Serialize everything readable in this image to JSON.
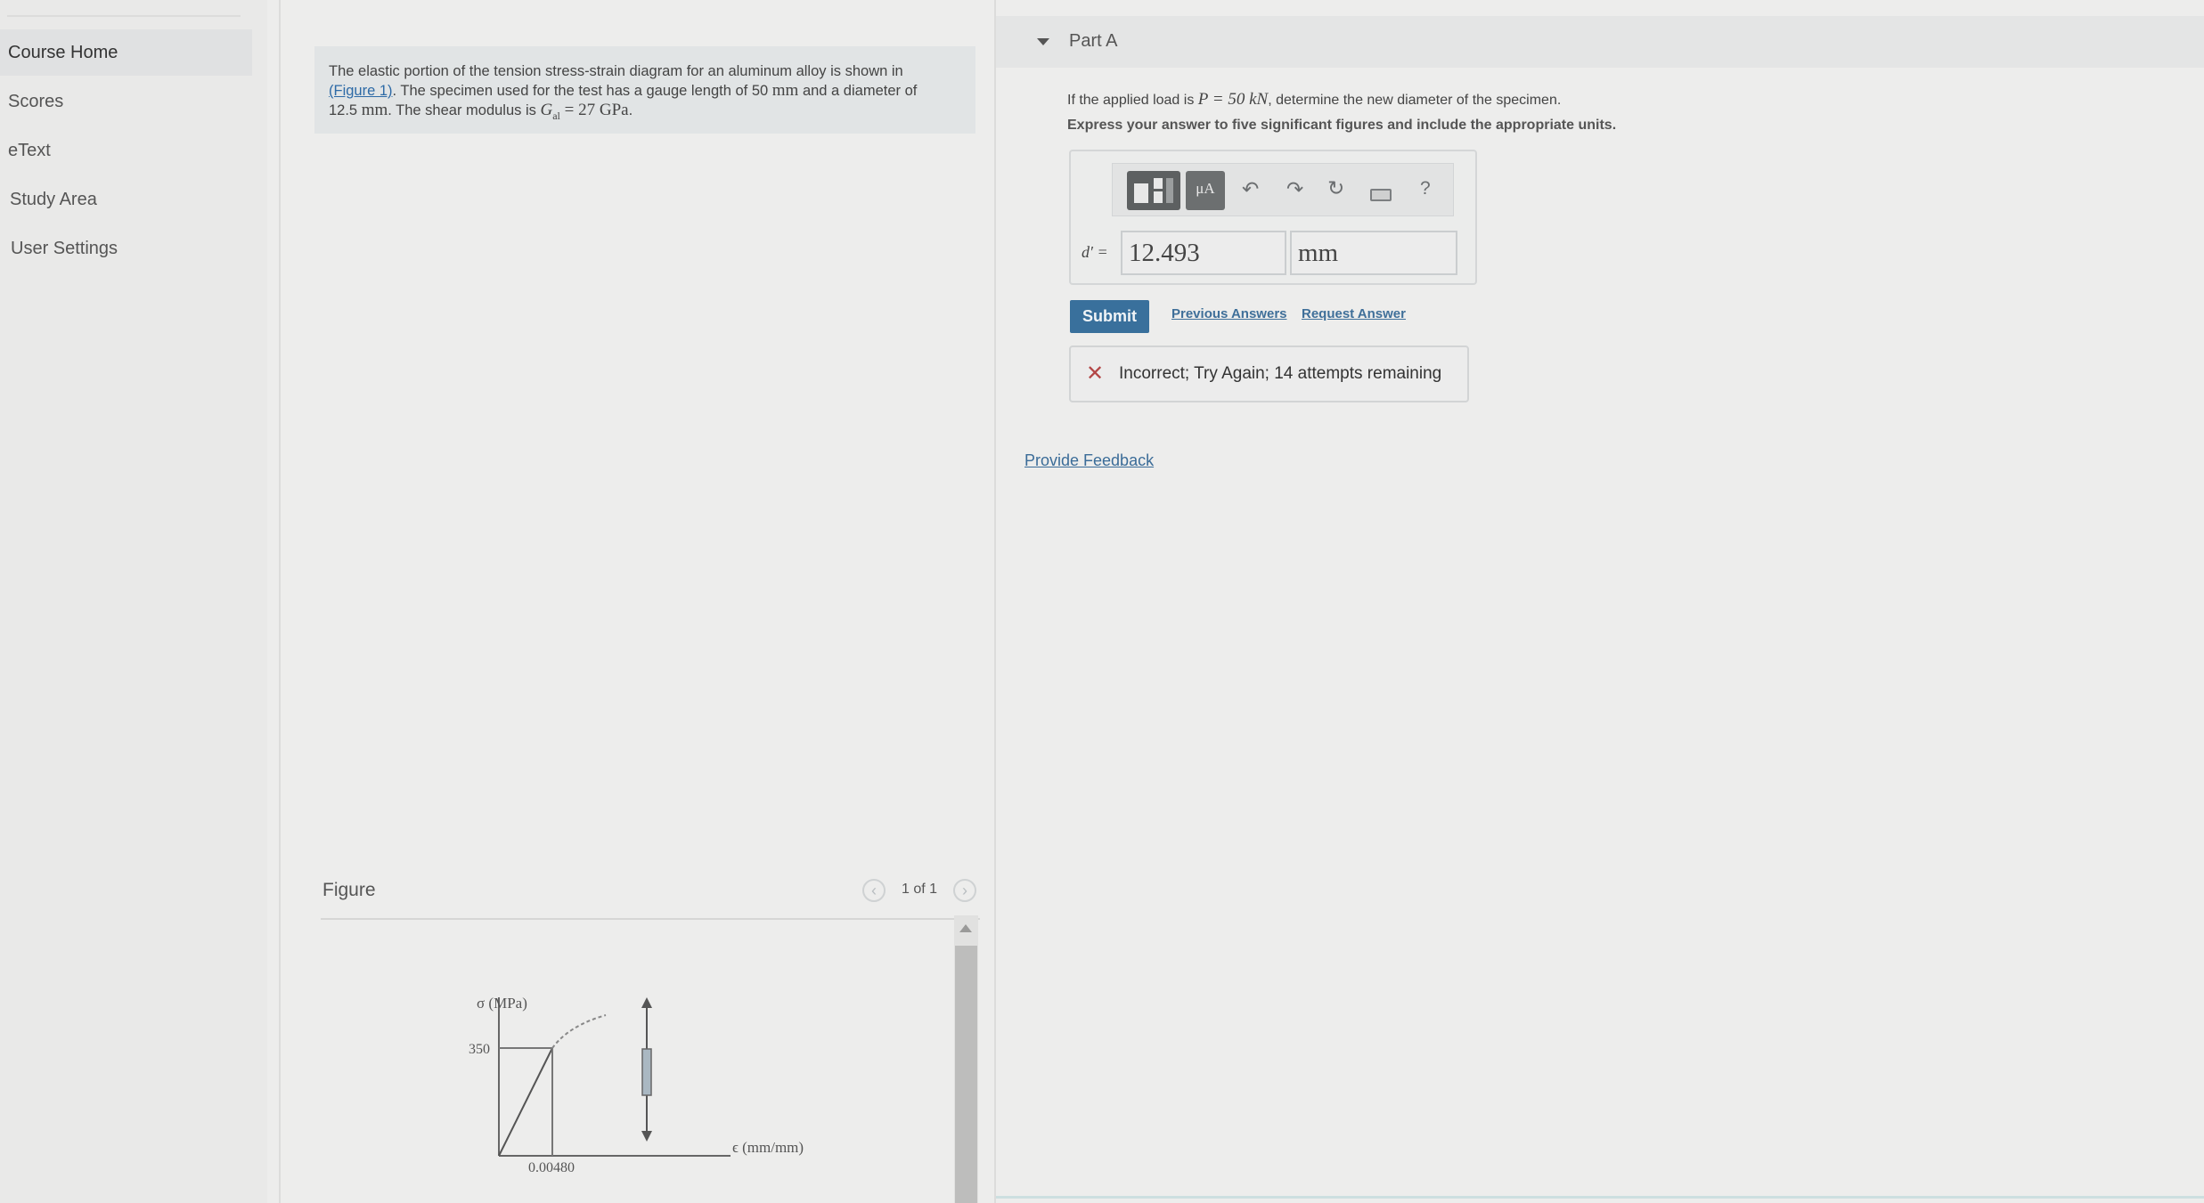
{
  "sidebar": {
    "items": [
      {
        "label": "Course Home",
        "active": true
      },
      {
        "label": "Scores"
      },
      {
        "label": "eText"
      },
      {
        "label": "Study Area"
      },
      {
        "label": "User Settings"
      }
    ]
  },
  "problem": {
    "text_1": "The elastic portion of the tension stress-strain diagram for an aluminum alloy is shown in",
    "figure_link": "(Figure 1)",
    "text_2": ". The specimen used for the test has a gauge length of 50",
    "unit_mm": "mm",
    "text_3": "and a diameter of",
    "diameter": "12.5",
    "text_4": ". The shear modulus is",
    "g_symbol": "G",
    "g_sub": "al",
    "g_value": "= 27 GPa",
    "end": "."
  },
  "figure": {
    "title": "Figure",
    "pager": "1 of 1",
    "prev_icon": "chevron-left-icon",
    "next_icon": "chevron-right-icon",
    "stress_axis_label": "σ (MPa)",
    "stress_tick": "350",
    "strain_tick": "0.00480",
    "strain_axis_label": "ϵ (mm/mm)",
    "yield_stress": 350,
    "yield_strain": 0.0048
  },
  "part_a": {
    "title": "Part A",
    "question_1": "If the applied load is",
    "load": "P = 50 kN",
    "question_2": ", determine the new diameter of the specimen.",
    "instruction": "Express your answer to five significant figures and include the appropriate units.",
    "variable": "d′ =",
    "value": "12.493",
    "unit": "mm",
    "toolbar": {
      "units_label": "μA",
      "help_label": "?",
      "icons": [
        "templates-icon",
        "units-icon",
        "undo-icon",
        "redo-icon",
        "reset-icon",
        "keyboard-icon",
        "help-icon"
      ]
    },
    "submit_label": "Submit",
    "previous_answers_label": "Previous Answers",
    "request_answer_label": "Request Answer",
    "feedback": "Incorrect; Try Again; 14 attempts remaining",
    "feedback_icon": "x-icon",
    "provide_feedback_label": "Provide Feedback",
    "error_color": "#b34646",
    "submit_color": "#39709c"
  }
}
